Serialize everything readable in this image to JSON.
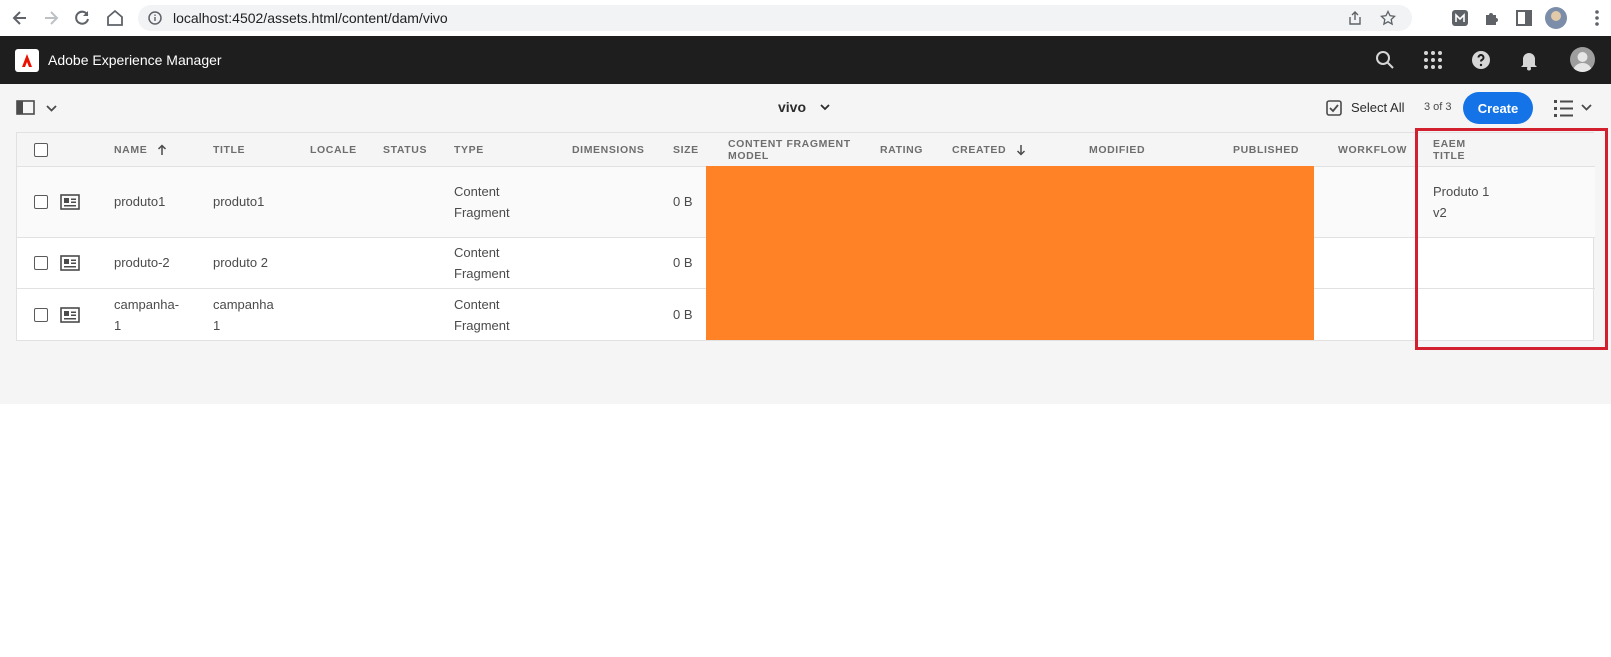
{
  "browser": {
    "url_host": "localhost",
    "url_path": ":4502/assets.html/content/dam/vivo"
  },
  "app": {
    "title": "Adobe Experience Manager"
  },
  "actionbar": {
    "folder": "vivo",
    "select_all_label": "Select All",
    "count": "3 of 3",
    "create_label": "Create"
  },
  "table": {
    "columns": [
      {
        "key": "name",
        "label": "Name",
        "sort": "ascending"
      },
      {
        "key": "title",
        "label": "Title"
      },
      {
        "key": "locale",
        "label": "Locale"
      },
      {
        "key": "status",
        "label": "Status"
      },
      {
        "key": "type",
        "label": "Type"
      },
      {
        "key": "dimensions",
        "label": "Dimensions"
      },
      {
        "key": "size",
        "label": "Size"
      },
      {
        "key": "cf_model",
        "label": "Content Fragment Model"
      },
      {
        "key": "rating",
        "label": "Rating"
      },
      {
        "key": "created",
        "label": "Created",
        "sort": "descending"
      },
      {
        "key": "modified",
        "label": "Modified"
      },
      {
        "key": "published",
        "label": "Published"
      },
      {
        "key": "workflow",
        "label": "Workflow"
      },
      {
        "key": "eaem_title",
        "label": "EAEM Title"
      }
    ],
    "rows": [
      {
        "name": "produto1",
        "title": "produto1",
        "type": "Content Fragment",
        "size": "0 B",
        "eaem_title": "Produto 1 v2"
      },
      {
        "name": "produto-2",
        "title": "produto 2",
        "type": "Content Fragment",
        "size": "0 B",
        "eaem_title": ""
      },
      {
        "name": "campanha-1",
        "title": "campanha 1",
        "type": "Content Fragment",
        "size": "0 B",
        "eaem_title": ""
      }
    ]
  },
  "colors": {
    "accent": "#1473e6",
    "redaction": "#ff8226",
    "highlight_border": "#d2202f",
    "header_bg": "#1e1e1e"
  }
}
